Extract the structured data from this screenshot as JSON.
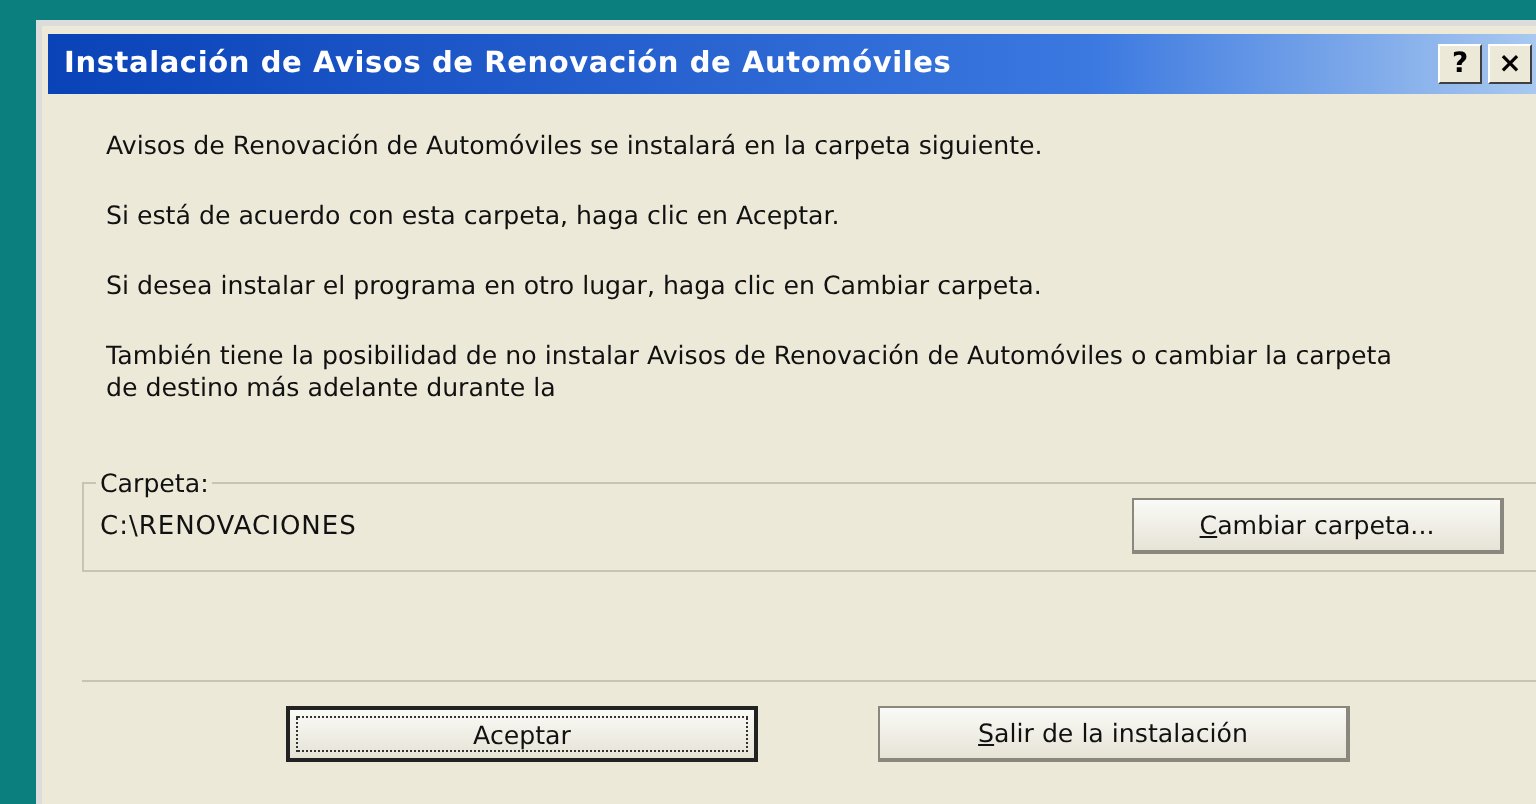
{
  "window": {
    "title": "Instalación de Avisos de Renovación de Automóviles",
    "title_buttons": [
      "?",
      "×"
    ]
  },
  "paragraphs": [
    "Avisos de Renovación de Automóviles se instalará en la carpeta siguiente.",
    "Si está de acuerdo con esta carpeta, haga clic en Aceptar.",
    "Si desea instalar el programa en otro lugar, haga clic en Cambiar carpeta.",
    "También tiene la posibilidad de no instalar Avisos de Renovación de Automóviles o cambiar la carpeta de destino más adelante durante la"
  ],
  "folder_group": {
    "legend": "Carpeta:",
    "path": "C:\\RENOVACIONES",
    "button": {
      "label": "Cambiar carpeta...",
      "mnemonic_underlined": true
    }
  },
  "buttons": [
    {
      "label": "Aceptar",
      "focused": true,
      "mnemonic_underlined": false
    },
    {
      "label": "Salir de la instalación",
      "focused": false,
      "mnemonic_underlined": true
    }
  ]
}
